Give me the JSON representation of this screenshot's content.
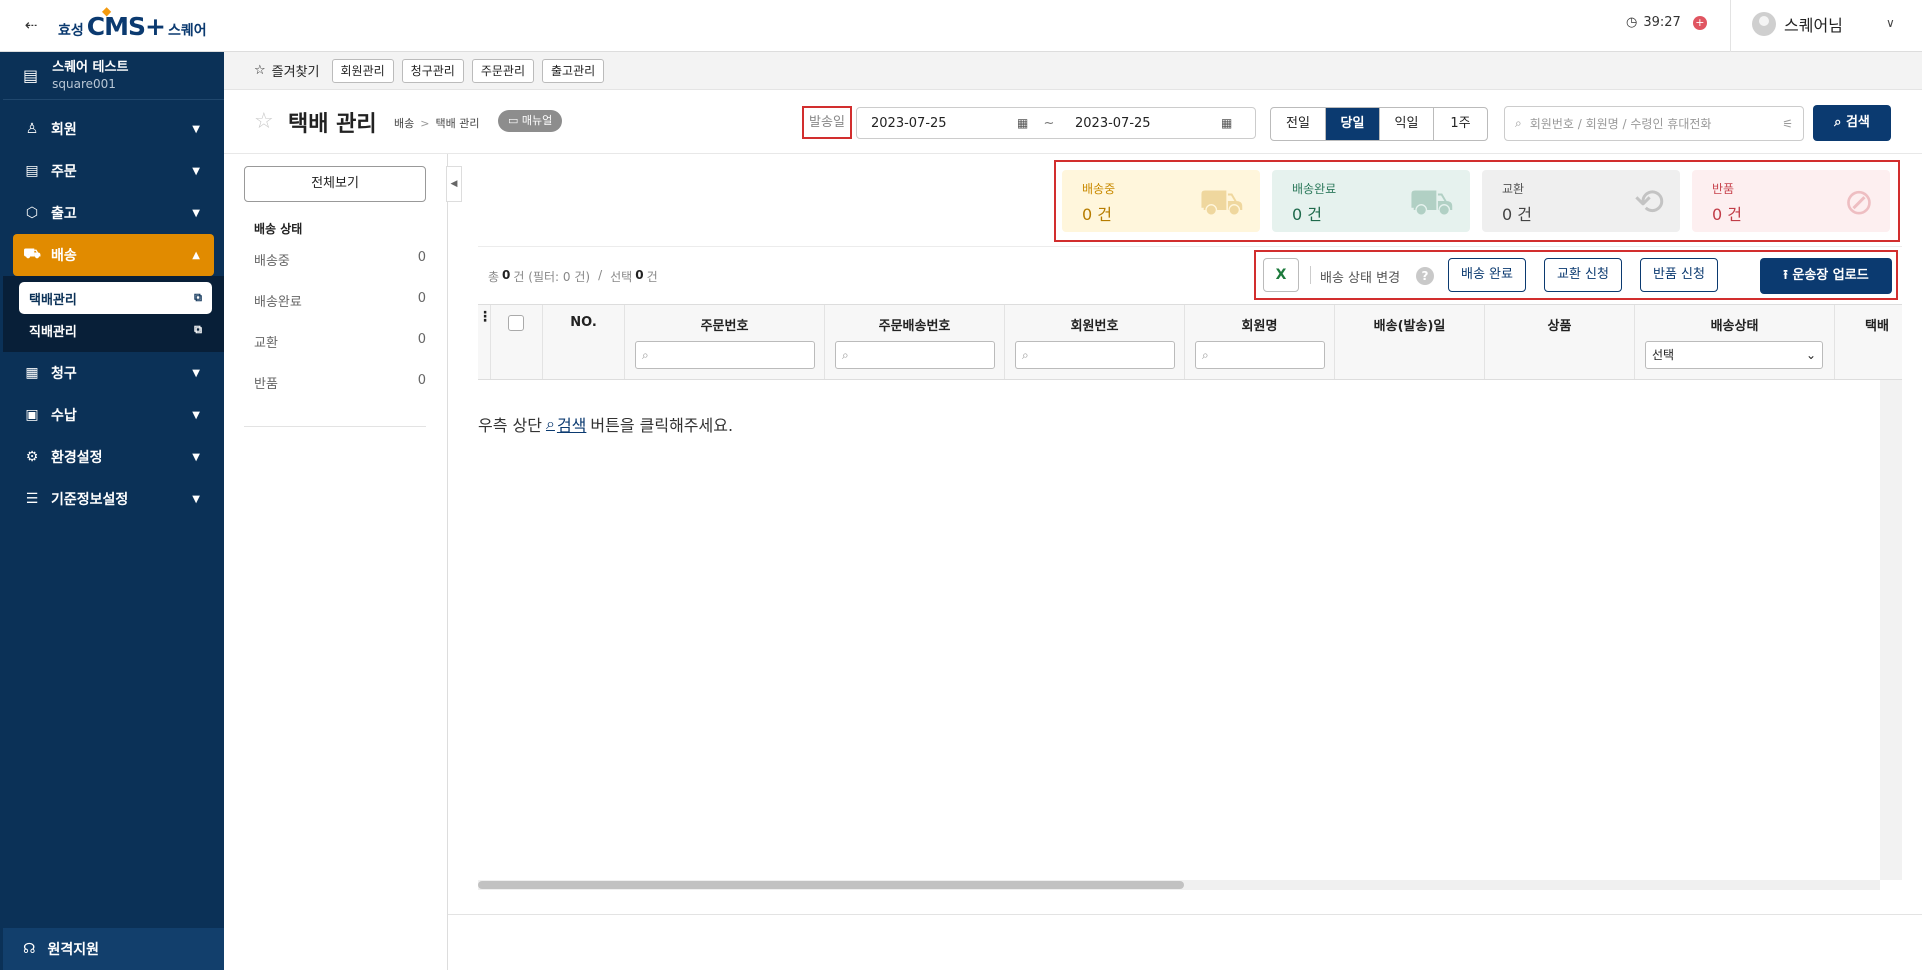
{
  "header": {
    "collapse_icon": "⇠",
    "logo_hyosung": "효성",
    "logo_cms": "CMS+",
    "logo_square": "스퀘어",
    "session_timer": "39:27",
    "user_name": "스퀘어님"
  },
  "sidebar": {
    "org_name": "스퀘어 테스트",
    "org_id": "square001",
    "items": [
      {
        "label": "회원",
        "icon": "user-icon"
      },
      {
        "label": "주문",
        "icon": "order-icon"
      },
      {
        "label": "출고",
        "icon": "box-icon"
      },
      {
        "label": "배송",
        "icon": "truck-icon"
      },
      {
        "label": "청구",
        "icon": "bill-icon"
      },
      {
        "label": "수납",
        "icon": "register-icon"
      },
      {
        "label": "환경설정",
        "icon": "gear-icon"
      },
      {
        "label": "기준정보설정",
        "icon": "sliders-icon"
      }
    ],
    "sub_items": [
      {
        "label": "택배관리"
      },
      {
        "label": "직배관리"
      }
    ],
    "remote_support": "원격지원"
  },
  "favorites": {
    "title": "즐겨찾기",
    "chips": [
      "회원관리",
      "청구관리",
      "주문관리",
      "출고관리"
    ]
  },
  "page": {
    "title": "택배 관리",
    "breadcrumb": [
      "배송",
      "택배 관리"
    ],
    "manual_label": "매뉴얼",
    "date_label": "발송일",
    "date_from": "2023-07-25",
    "date_to": "2023-07-25",
    "date_tilde": "~",
    "range_buttons": [
      "전일",
      "당일",
      "익일",
      "1주"
    ],
    "range_selected": "당일",
    "search_placeholder": "회원번호 / 회원명 / 수령인 휴대전화",
    "search_button": "검색"
  },
  "left_panel": {
    "all_button": "전체보기",
    "status_title": "배송 상태",
    "statuses": [
      {
        "label": "배송중",
        "count": "0"
      },
      {
        "label": "배송완료",
        "count": "0"
      },
      {
        "label": "교환",
        "count": "0"
      },
      {
        "label": "반품",
        "count": "0"
      }
    ]
  },
  "cards": [
    {
      "title": "배송중",
      "value": "0 건",
      "color": "#c98a00"
    },
    {
      "title": "배송완료",
      "value": "0 건",
      "color": "#2d7a5c"
    },
    {
      "title": "교환",
      "value": "0 건",
      "color": "#555555"
    },
    {
      "title": "반품",
      "value": "0 건",
      "color": "#c8444e"
    }
  ],
  "summary": {
    "total_prefix": "총",
    "total_count": "0",
    "total_suffix": "건 (필터: 0 건)",
    "sep": "/",
    "selected_prefix": "선택",
    "selected_count": "0",
    "selected_suffix": "건"
  },
  "actions": {
    "status_change_label": "배송 상태 변경",
    "help": "?",
    "btn_complete": "배송 완료",
    "btn_exchange": "교환 신청",
    "btn_return": "반품 신청",
    "btn_upload": "운송장 업로드"
  },
  "grid": {
    "columns": [
      "NO.",
      "주문번호",
      "주문배송번호",
      "회원번호",
      "회원명",
      "배송(발송)일",
      "상품",
      "배송상태",
      "택배"
    ],
    "status_select": "선택"
  },
  "empty": {
    "before": "우측 상단",
    "link": "검색",
    "after": "버튼을 클릭해주세요."
  }
}
